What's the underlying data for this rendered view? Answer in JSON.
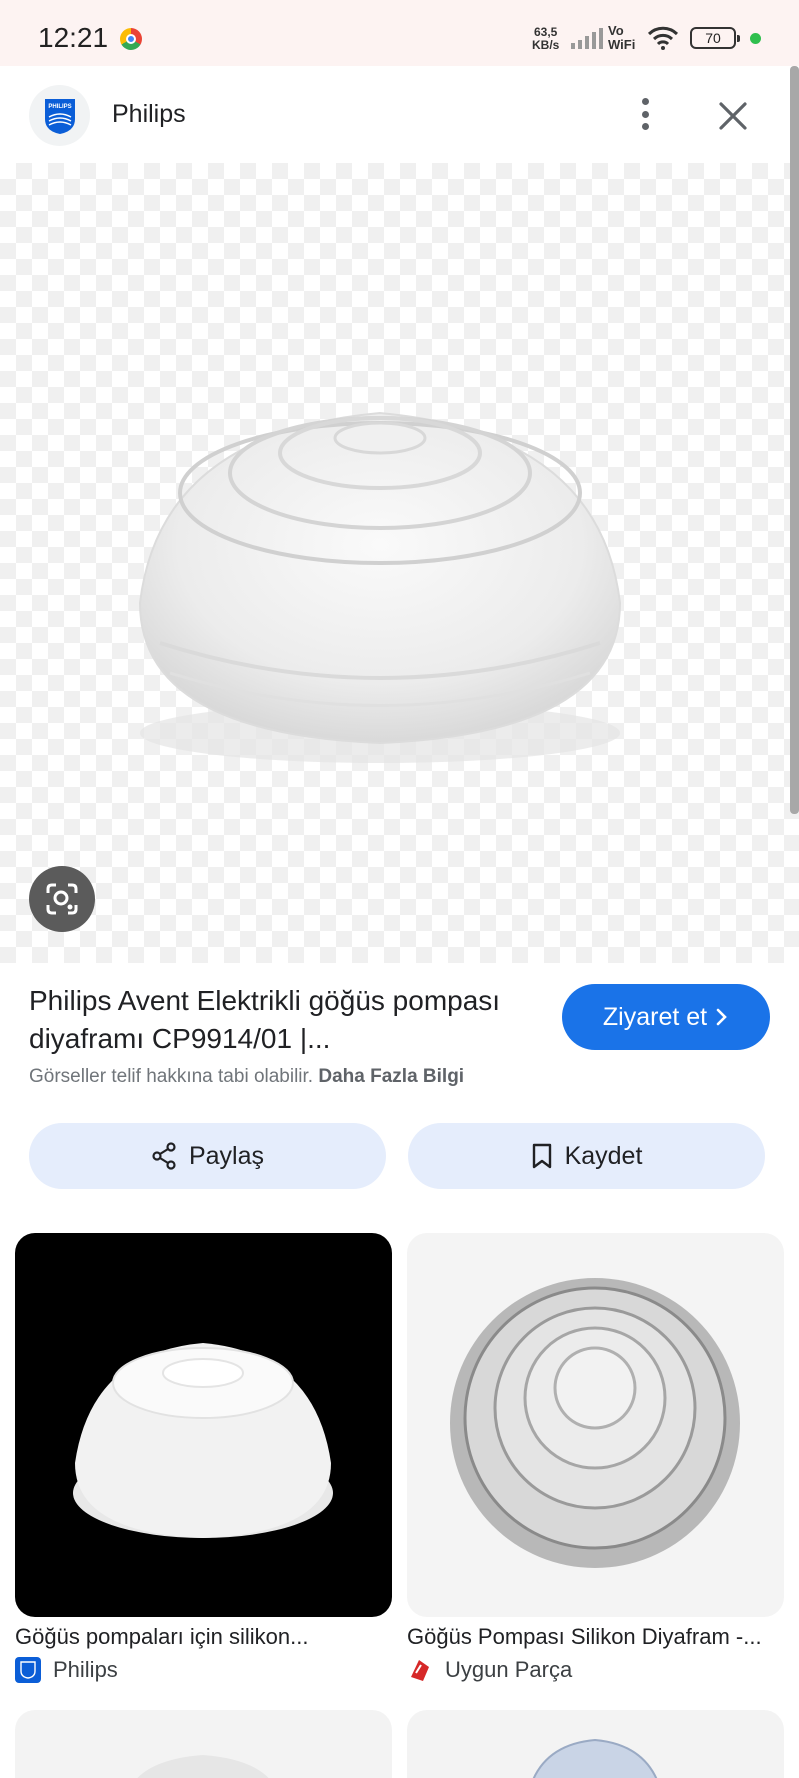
{
  "status_bar": {
    "time": "12:21",
    "net_speed_value": "63,5",
    "net_speed_unit": "KB/s",
    "vo_label": "Vo",
    "wifi_label": "WiFi",
    "battery": "70"
  },
  "header": {
    "site_name": "Philips",
    "logo_text": "PHILIPS"
  },
  "result": {
    "title": "Philips Avent Elektrikli göğüs pompası diyaframı CP9914/01 |...",
    "visit_label": "Ziyaret et",
    "copyright_text": "Görseller telif hakkına tabi olabilir.",
    "learn_more": "Daha Fazla Bilgi"
  },
  "actions": {
    "share_label": "Paylaş",
    "save_label": "Kaydet"
  },
  "related": [
    {
      "caption": "Göğüs pompaları için silikon...",
      "source": "Philips"
    },
    {
      "caption": "Göğüs Pompası Silikon Diyafram -...",
      "source": "Uygun Parça"
    }
  ],
  "colors": {
    "accent": "#1a73e8",
    "action_bg": "#e5edfc",
    "status_bg": "#fdf3f2"
  }
}
